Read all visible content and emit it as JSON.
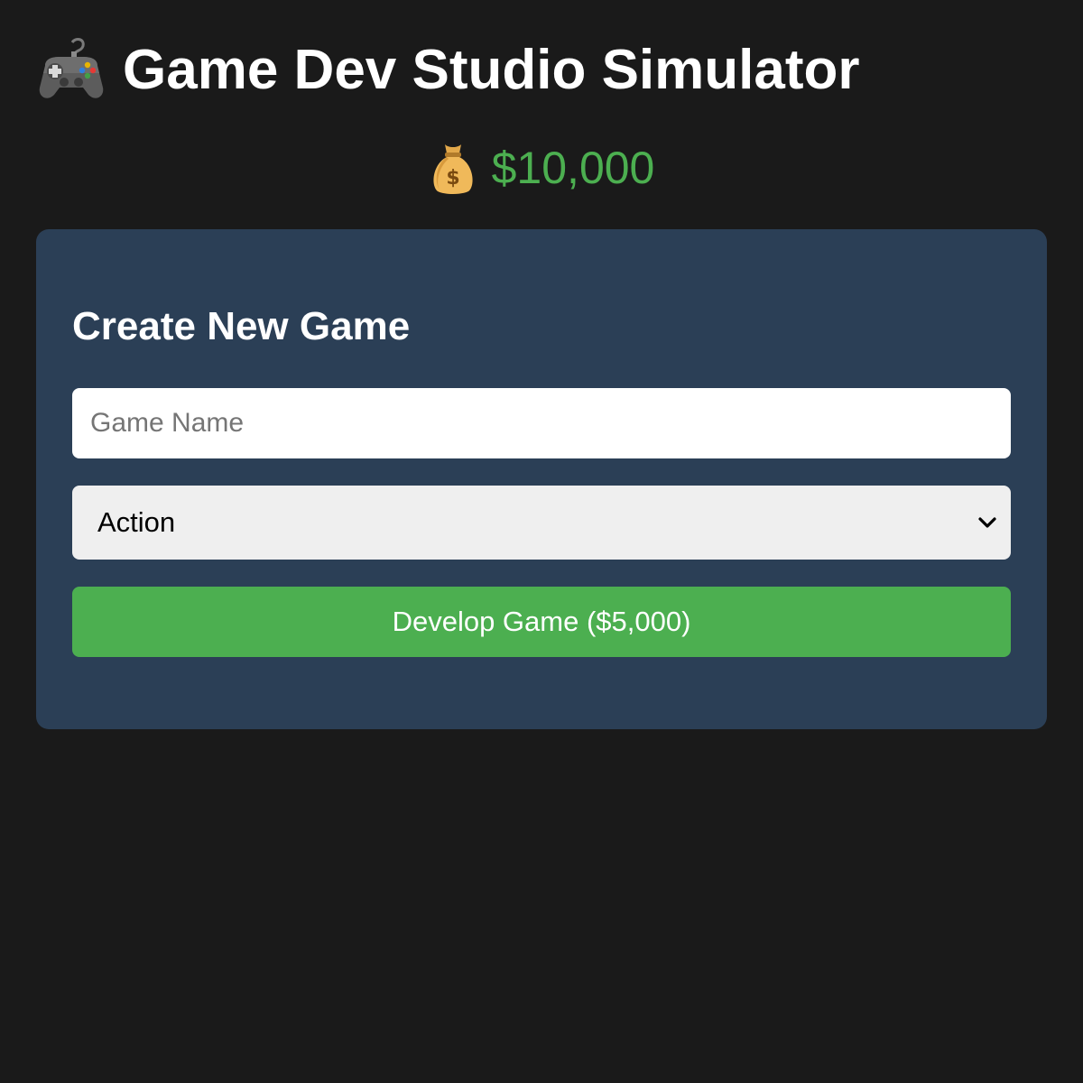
{
  "header": {
    "icon": "gamepad-icon",
    "title": "Game Dev Studio Simulator"
  },
  "balance": {
    "icon": "money-bag-icon",
    "amount": "$10,000",
    "color": "#4caf50"
  },
  "create_panel": {
    "background": "#2b3f56",
    "title": "Create New Game",
    "name_input": {
      "value": "",
      "placeholder": "Game Name"
    },
    "genre_select": {
      "selected": "Action",
      "icon": "chevron-down-icon"
    },
    "develop_button": {
      "label": "Develop Game ($5,000)",
      "color": "#4caf50"
    }
  }
}
